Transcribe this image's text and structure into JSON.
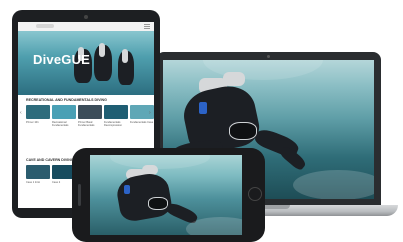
{
  "tablet": {
    "logo": "DiveGUE",
    "section_1_title": "RECREATIONAL AND FUNDAMENTALS DIVING",
    "section_2_title": "CAVE AND CAVERN DIVING",
    "row_1": [
      {
        "caption": "Primer 101",
        "color": "#2e6c7c"
      },
      {
        "caption": "Recreational Fundamentals",
        "color": "#4aa0b5"
      },
      {
        "caption": "Primer Basic Fundamentals",
        "color": "#3b4d5a"
      },
      {
        "caption": "Fundamentals Decompression",
        "color": "#1f5e73"
      },
      {
        "caption": "Fundamentals Cave",
        "color": "#5fa7b6"
      }
    ],
    "row_2": [
      {
        "caption": "Cave 1 Intro",
        "color": "#2b5c6e"
      },
      {
        "caption": "Cave 2",
        "color": "#174c5f"
      },
      {
        "caption": "Cavern",
        "color": "#6fb0bd"
      }
    ]
  },
  "icons": {
    "laptop_camera": "camera-dot-icon",
    "tablet_camera": "camera-dot-icon",
    "phone_home": "home-button-icon",
    "next_arrow": "chevron-right-icon",
    "prev_arrow": "chevron-left-icon"
  }
}
